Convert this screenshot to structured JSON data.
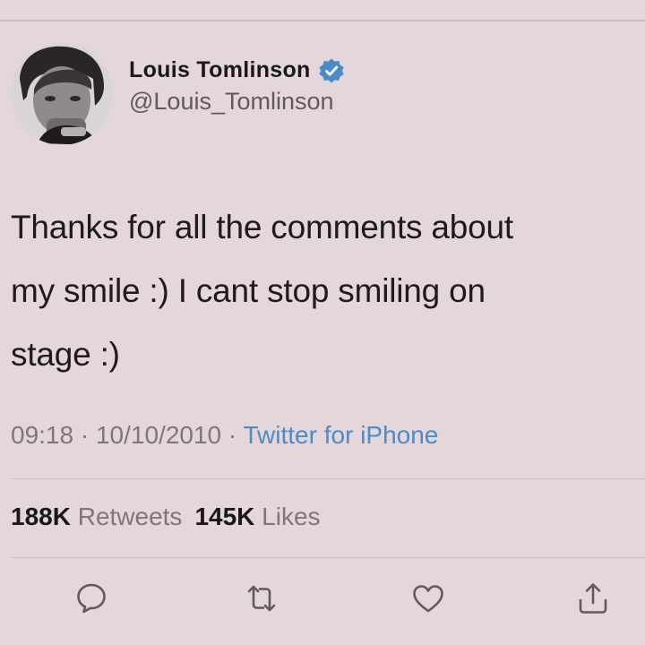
{
  "tweet": {
    "author": {
      "display_name": "Louis Tomlinson",
      "handle": "@Louis_Tomlinson",
      "verified": true
    },
    "text": "Thanks for all the comments about\nmy smile :) I cant stop smiling on\nstage :)",
    "time": "09:18",
    "date": "10/10/2010",
    "separator": " · ",
    "source": "Twitter for iPhone",
    "stats": {
      "retweets_count": "188K",
      "retweets_label": "Retweets",
      "likes_count": "145K",
      "likes_label": "Likes"
    }
  },
  "icons": {
    "verified": "verified-badge-icon",
    "reply": "reply-icon",
    "retweet": "retweet-icon",
    "like": "heart-icon",
    "share": "share-icon"
  },
  "colors": {
    "background": "#e5d6d9",
    "link": "#4a8cc8",
    "muted": "#7d777b",
    "verified": "#4a8cc8"
  }
}
